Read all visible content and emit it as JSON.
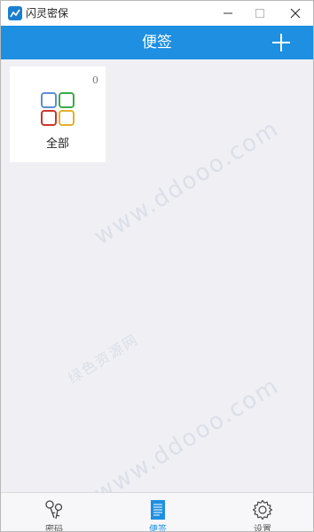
{
  "window": {
    "title": "闪灵密保",
    "controls": [
      "minimize",
      "maximize",
      "close"
    ]
  },
  "header": {
    "title": "便签",
    "add_icon": "plus-icon"
  },
  "categories": [
    {
      "label": "全部",
      "count": "0",
      "icon": "grid-icon"
    }
  ],
  "watermarks": [
    "www.ddooo.com",
    "绿色资源网",
    "www.ddooo.com"
  ],
  "bottom_nav": {
    "items": [
      {
        "label": "密码",
        "icon": "keys-icon",
        "active": false
      },
      {
        "label": "便签",
        "icon": "notes-icon",
        "active": true
      },
      {
        "label": "设置",
        "icon": "gear-icon",
        "active": false
      }
    ]
  },
  "colors": {
    "primary": "#1e8fe1",
    "background": "#f0f0f4",
    "grid_blue": "#5b8fd6",
    "grid_green": "#3ea84a",
    "grid_red": "#c8372d",
    "grid_yellow": "#e0b12a"
  }
}
